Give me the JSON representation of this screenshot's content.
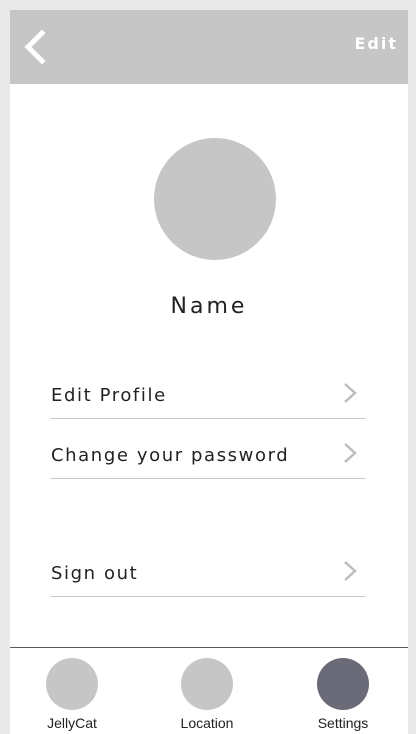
{
  "header": {
    "back_icon": "chevron-left-icon",
    "edit_label": "Edit"
  },
  "profile": {
    "name": "Name"
  },
  "menu": {
    "items": [
      {
        "label": "Edit Profile",
        "icon": "chevron-right-icon"
      },
      {
        "label": "Change your password",
        "icon": "chevron-right-icon"
      },
      {
        "label": "Sign out",
        "icon": "chevron-right-icon"
      }
    ]
  },
  "tabbar": {
    "tabs": [
      {
        "label": "JellyCat",
        "active": false
      },
      {
        "label": "Location",
        "active": false
      },
      {
        "label": "Settings",
        "active": true
      }
    ]
  },
  "colors": {
    "header_bg": "#c6c6c6",
    "avatar_bg": "#c6c6c6",
    "tab_active": "#6a6a78",
    "chevron": "#bdbdbd"
  }
}
